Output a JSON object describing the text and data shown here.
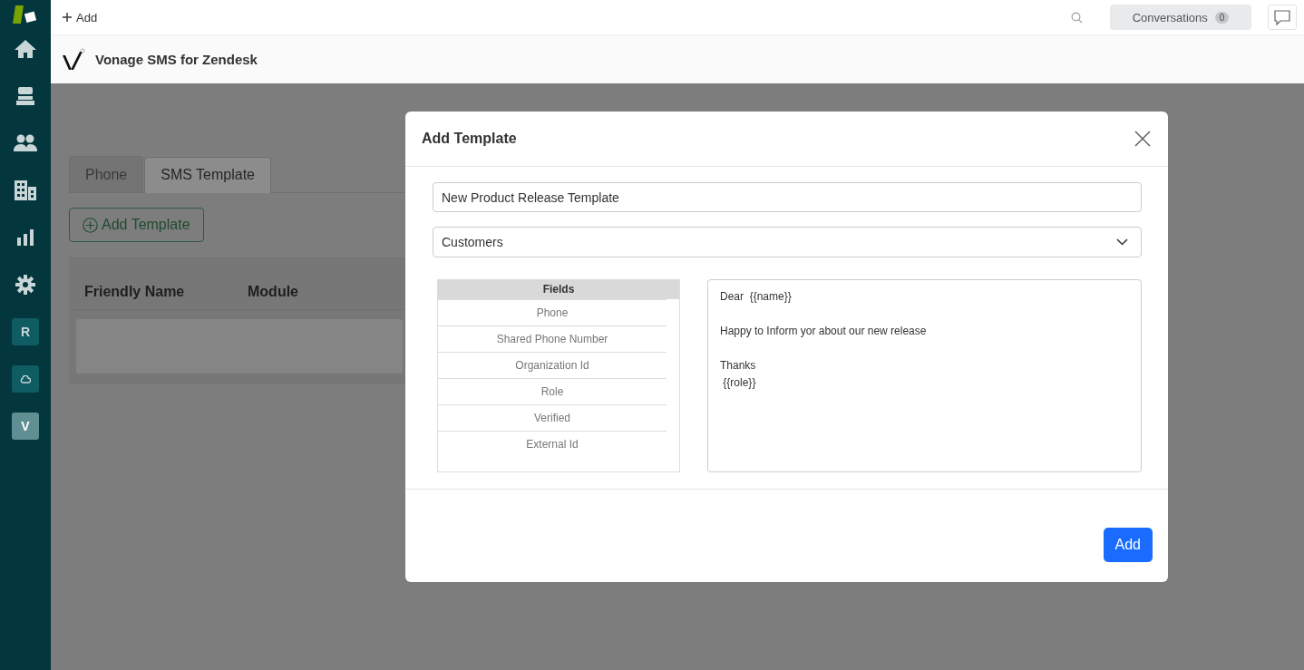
{
  "sidebar": {
    "items": [
      {
        "kind": "logo"
      },
      {
        "kind": "home"
      },
      {
        "kind": "tickets"
      },
      {
        "kind": "users"
      },
      {
        "kind": "buildings"
      },
      {
        "kind": "reports"
      },
      {
        "kind": "settings"
      },
      {
        "kind": "app",
        "label": "R"
      },
      {
        "kind": "cloud"
      },
      {
        "kind": "app",
        "label": "V"
      }
    ]
  },
  "topbar": {
    "add_label": "Add",
    "conversations": {
      "label": "Conversations",
      "count": "0"
    }
  },
  "app_header": {
    "title": "Vonage SMS for Zendesk"
  },
  "tabs": [
    {
      "label": "Phone",
      "selected": false
    },
    {
      "label": "SMS Template",
      "selected": true
    }
  ],
  "add_template_button": "Add Template",
  "table": {
    "columns": [
      "Friendly Name",
      "Module"
    ]
  },
  "modal": {
    "title": "Add Template",
    "name_value": "New Product Release Template",
    "module_value": "Customers",
    "fields": {
      "header": "Fields",
      "items": [
        "Phone",
        "Shared Phone Number",
        "Organization Id",
        "Role",
        "Verified",
        "External Id"
      ]
    },
    "message": "Dear  {{name}}\n\nHappy to Inform yor about our new release\n\nThanks\n {{role}}",
    "submit": "Add"
  }
}
